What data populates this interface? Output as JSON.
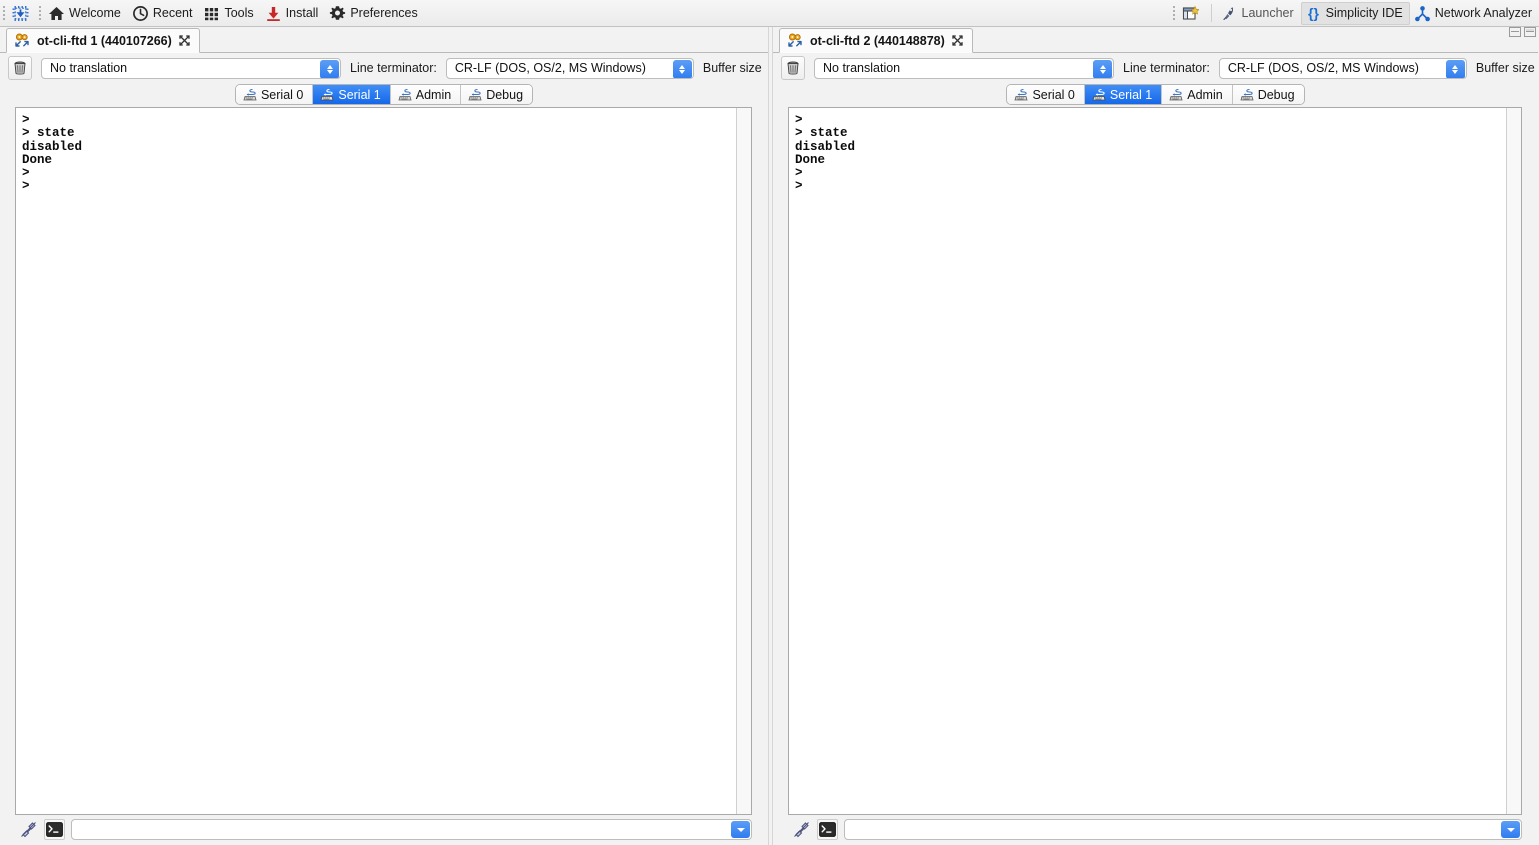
{
  "toolbar": {
    "left_items": [
      {
        "label": "",
        "icon": "chip-flash-icon",
        "name": "flash-programmer-button"
      },
      {
        "label": "Welcome",
        "icon": "home-icon",
        "name": "welcome-button"
      },
      {
        "label": "Recent",
        "icon": "clock-icon",
        "name": "recent-button"
      },
      {
        "label": "Tools",
        "icon": "grid-icon",
        "name": "tools-button"
      },
      {
        "label": "Install",
        "icon": "download-icon",
        "name": "install-button"
      },
      {
        "label": "Preferences",
        "icon": "gear-icon",
        "name": "preferences-button"
      }
    ],
    "right_items": [
      {
        "label": "",
        "icon": "new-perspective-icon",
        "name": "open-perspective-button",
        "active": false
      },
      {
        "label": "Launcher",
        "icon": "rocket-icon",
        "name": "perspective-launcher",
        "active": false
      },
      {
        "label": "Simplicity IDE",
        "icon": "braces-icon",
        "name": "perspective-simplicity-ide",
        "active": true
      },
      {
        "label": "Network Analyzer",
        "icon": "network-icon",
        "name": "perspective-network-analyzer",
        "active": false
      }
    ],
    "window_buttons": {
      "minimize": "Minimize",
      "maximize": "Maximize"
    }
  },
  "accent": {
    "blue": "#1668e8",
    "blue_light": "#3f8ef7",
    "tab_selected_text": "#ffffff"
  },
  "panels": [
    {
      "tab": {
        "title": "ot-cli-ftd 1 (440107266)",
        "close": "✕"
      },
      "options": {
        "clear_button": "clear-console-button",
        "translation_value": "No translation",
        "terminator_label": "Line terminator:",
        "terminator_value": "CR-LF  (DOS, OS/2, MS Windows)",
        "buffer_label": "Buffer size"
      },
      "subtabs": [
        {
          "label": "Serial 0",
          "selected": false
        },
        {
          "label": "Serial 1",
          "selected": true
        },
        {
          "label": "Admin",
          "selected": false
        },
        {
          "label": "Debug",
          "selected": false
        }
      ],
      "console_text": ">\n> state\ndisabled\nDone\n>\n>",
      "command_input": {
        "value": "",
        "placeholder": ""
      }
    },
    {
      "tab": {
        "title": "ot-cli-ftd 2 (440148878)",
        "close": "✕"
      },
      "options": {
        "clear_button": "clear-console-button",
        "translation_value": "No translation",
        "terminator_label": "Line terminator:",
        "terminator_value": "CR-LF  (DOS, OS/2, MS Windows)",
        "buffer_label": "Buffer size"
      },
      "subtabs": [
        {
          "label": "Serial 0",
          "selected": false
        },
        {
          "label": "Serial 1",
          "selected": true
        },
        {
          "label": "Admin",
          "selected": false
        },
        {
          "label": "Debug",
          "selected": false
        }
      ],
      "console_text": ">\n> state\ndisabled\nDone\n>\n>",
      "command_input": {
        "value": "",
        "placeholder": ""
      }
    }
  ]
}
